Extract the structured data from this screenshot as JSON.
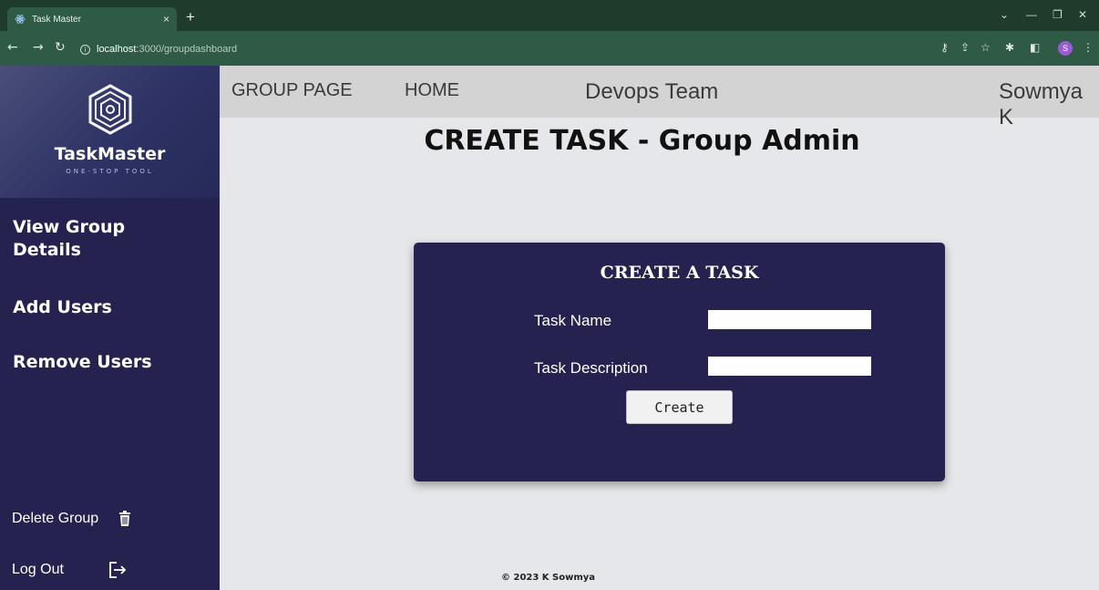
{
  "browser": {
    "tab_title": "Task Master",
    "tab_close": "×",
    "new_tab": "+",
    "url_host": "localhost",
    "url_path": ":3000/groupdashboard",
    "info_icon": "i",
    "profile_initial": "S",
    "icons": [
      "back-icon",
      "forward-icon",
      "reload-icon",
      "info-icon",
      "key-icon",
      "share-icon",
      "star-icon",
      "extensions-icon",
      "sidepanel-icon",
      "menu-icon"
    ]
  },
  "sidebar": {
    "brand": "TaskMaster",
    "tagline": "ONE-STOP TOOL",
    "links": [
      "View Group Details",
      "Add Users",
      "Remove Users"
    ],
    "delete_group": "Delete Group",
    "log_out": "Log Out"
  },
  "topnav": {
    "group_page": "GROUP PAGE",
    "home": "HOME",
    "team_name": "Devops Team",
    "user_name": "Sowmya K"
  },
  "main": {
    "heading": "CREATE TASK - Group Admin",
    "form": {
      "title": "CREATE A TASK",
      "task_name_label": "Task Name",
      "task_name_value": "",
      "task_description_label": "Task Description",
      "task_description_value": "",
      "create_label": "Create"
    }
  },
  "footer": {
    "copyright": "© 2023 K Sowmya"
  },
  "colors": {
    "sidebar": "#252250",
    "card": "#252250",
    "topnav": "#d3d3d3",
    "page_bg": "#e6e7ea",
    "browser_frame": "#2f5a45"
  }
}
